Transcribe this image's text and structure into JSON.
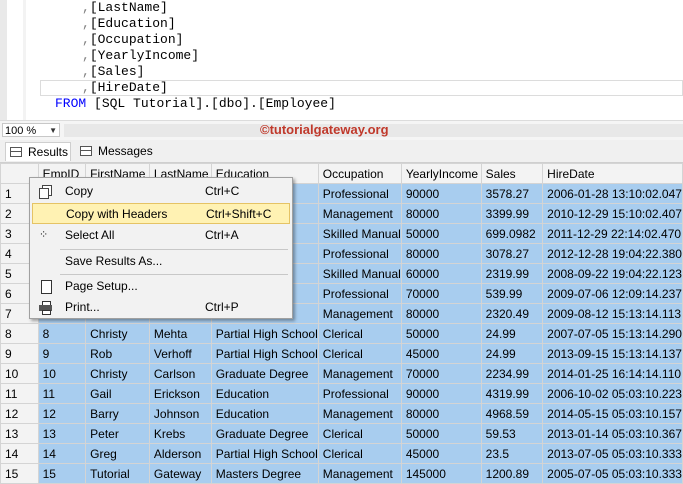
{
  "editor": {
    "lines": [
      {
        "prefix": ",",
        "text": "[LastName]"
      },
      {
        "prefix": ",",
        "text": "[Education]"
      },
      {
        "prefix": ",",
        "text": "[Occupation]"
      },
      {
        "prefix": ",",
        "text": "[YearlyIncome]"
      },
      {
        "prefix": ",",
        "text": "[Sales]"
      },
      {
        "prefix": ",",
        "text": "[HireDate]"
      }
    ],
    "from_keyword": "FROM",
    "from_table": "[SQL Tutorial].[dbo].[Employee]"
  },
  "zoom": {
    "value": "100 %"
  },
  "watermark": "©tutorialgateway.org",
  "tabs": [
    {
      "label": "Results",
      "icon": "grid-icon",
      "active": true
    },
    {
      "label": "Messages",
      "icon": "messages-icon",
      "active": false
    }
  ],
  "grid": {
    "columns": [
      "",
      "EmpID",
      "FirstName",
      "LastName",
      "Education",
      "Occupation",
      "YearlyIncome",
      "Sales",
      "HireDate"
    ],
    "rows": [
      [
        "1",
        "1",
        "",
        "",
        "",
        "Professional",
        "90000",
        "3578.27",
        "2006-01-28 13:10:02.047"
      ],
      [
        "2",
        "2",
        "",
        "",
        "",
        "Management",
        "80000",
        "3399.99",
        "2010-12-29 15:10:02.407"
      ],
      [
        "3",
        "3",
        "",
        "",
        "",
        "Skilled Manual",
        "50000",
        "699.0982",
        "2011-12-29 22:14:02.470"
      ],
      [
        "4",
        "4",
        "",
        "",
        "",
        "Professional",
        "80000",
        "3078.27",
        "2012-12-28 19:04:22.380"
      ],
      [
        "5",
        "5",
        "",
        "",
        "",
        "Skilled Manual",
        "60000",
        "2319.99",
        "2008-09-22 19:04:22.123"
      ],
      [
        "6",
        "6",
        "",
        "",
        "",
        "Professional",
        "70000",
        "539.99",
        "2009-07-06 12:09:14.237"
      ],
      [
        "7",
        "7",
        "",
        "",
        "e",
        "Management",
        "80000",
        "2320.49",
        "2009-08-12 15:13:14.113"
      ],
      [
        "8",
        "8",
        "Christy",
        "Mehta",
        "Partial High School",
        "Clerical",
        "50000",
        "24.99",
        "2007-07-05 15:13:14.290"
      ],
      [
        "9",
        "9",
        "Rob",
        "Verhoff",
        "Partial High School",
        "Clerical",
        "45000",
        "24.99",
        "2013-09-15 15:13:14.137"
      ],
      [
        "10",
        "10",
        "Christy",
        "Carlson",
        "Graduate Degree",
        "Management",
        "70000",
        "2234.99",
        "2014-01-25 16:14:14.110"
      ],
      [
        "11",
        "11",
        "Gail",
        "Erickson",
        "Education",
        "Professional",
        "90000",
        "4319.99",
        "2006-10-02 05:03:10.223"
      ],
      [
        "12",
        "12",
        "Barry",
        "Johnson",
        "Education",
        "Management",
        "80000",
        "4968.59",
        "2014-05-15 05:03:10.157"
      ],
      [
        "13",
        "13",
        "Peter",
        "Krebs",
        "Graduate Degree",
        "Clerical",
        "50000",
        "59.53",
        "2013-01-14 05:03:10.367"
      ],
      [
        "14",
        "14",
        "Greg",
        "Alderson",
        "Partial High School",
        "Clerical",
        "45000",
        "23.5",
        "2013-07-05 05:03:10.333"
      ],
      [
        "15",
        "15",
        "Tutorial",
        "Gateway",
        "Masters Degree",
        "Management",
        "145000",
        "1200.89",
        "2005-07-05 05:03:10.333"
      ]
    ]
  },
  "context_menu": {
    "items": [
      {
        "label": "Copy",
        "shortcut": "Ctrl+C",
        "icon": "copy-icon"
      },
      {
        "label": "Copy with Headers",
        "shortcut": "Ctrl+Shift+C",
        "icon": "",
        "highlighted": true
      },
      {
        "label": "Select All",
        "shortcut": "Ctrl+A",
        "icon": "select-all-icon"
      },
      {
        "label": "Save Results As...",
        "shortcut": "",
        "icon": ""
      },
      {
        "label": "Page Setup...",
        "shortcut": "",
        "icon": "page-setup-icon"
      },
      {
        "label": "Print...",
        "shortcut": "Ctrl+P",
        "icon": "print-icon"
      }
    ]
  }
}
